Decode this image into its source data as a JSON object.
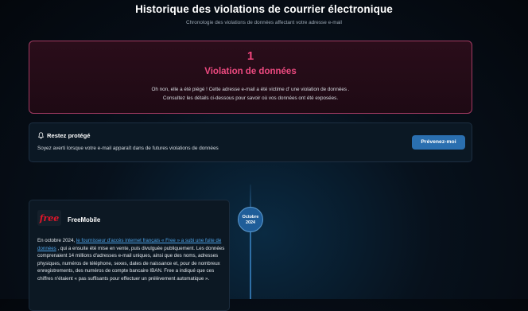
{
  "header": {
    "title": "Historique des violations de courrier électronique",
    "subtitle": "Chronologie des violations de données affectant votre adresse e-mail"
  },
  "breach_summary": {
    "count": "1",
    "title": "Violation de données",
    "line1": "Oh non, elle a été piégé ! Cette adresse e-mail a été victime d' une violation de données .",
    "line2": "Consultez les détails ci-dessous pour savoir où vos données ont été exposées."
  },
  "protect": {
    "title": "Restez protégé",
    "text": "Soyez averti lorsque votre e-mail apparaît dans de futures violations de données",
    "button": "Prévenez-moi"
  },
  "timeline": {
    "date_month": "Octobre",
    "date_year": "2024"
  },
  "breach_card": {
    "logo_text": "free",
    "name": "FreeMobile",
    "desc_before": "En octobre 2024, ",
    "desc_link": "le fournisseur d'accès internet français « Free » a subi une fuite de données",
    "desc_after": " , qui a ensuite été mise en vente, puis divulguée publiquement. Les données comprenaient 14 millions d'adresses e-mail uniques, ainsi que des noms, adresses physiques, numéros de téléphone, sexes, dates de naissance et, pour de nombreux enregistrements, des numéros de compte bancaire IBAN. Free a indiqué que ces chiffres n'étaient « pas suffisants pour effectuer un prélèvement automatique »."
  },
  "icons": {
    "bell": "bell-icon",
    "logo": "free-logo"
  },
  "colors": {
    "accent_pink": "#ee4a80",
    "button_blue": "#2a6fb0",
    "link_blue": "#4da3e8",
    "logo_red": "#e2162a"
  }
}
